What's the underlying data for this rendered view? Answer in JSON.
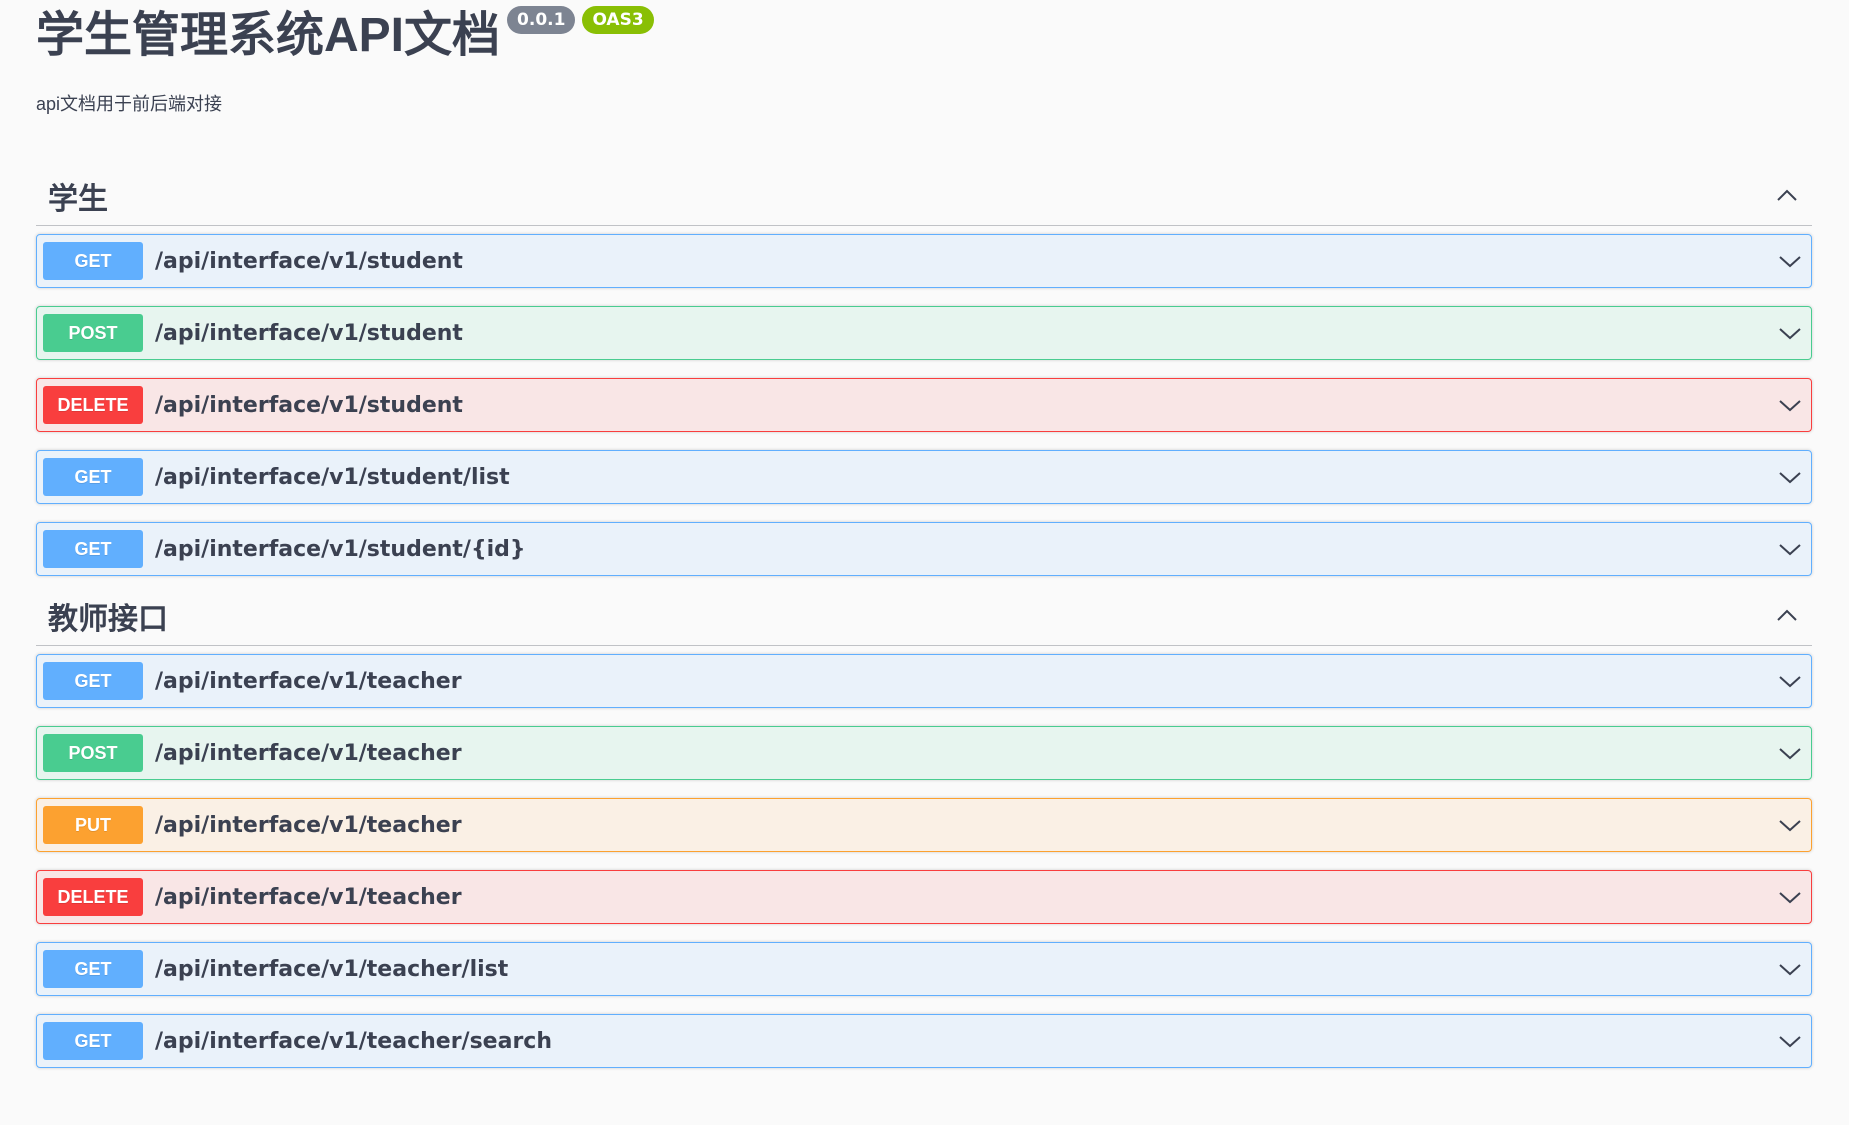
{
  "info": {
    "title": "学生管理系统API文档",
    "version": "0.0.1",
    "oas": "OAS3",
    "description": "api文档用于前后端对接"
  },
  "tags": [
    {
      "name": "学生",
      "operations": [
        {
          "method": "GET",
          "path": "/api/interface/v1/student"
        },
        {
          "method": "POST",
          "path": "/api/interface/v1/student"
        },
        {
          "method": "DELETE",
          "path": "/api/interface/v1/student"
        },
        {
          "method": "GET",
          "path": "/api/interface/v1/student/list"
        },
        {
          "method": "GET",
          "path": "/api/interface/v1/student/{id}"
        }
      ]
    },
    {
      "name": "教师接口",
      "operations": [
        {
          "method": "GET",
          "path": "/api/interface/v1/teacher"
        },
        {
          "method": "POST",
          "path": "/api/interface/v1/teacher"
        },
        {
          "method": "PUT",
          "path": "/api/interface/v1/teacher"
        },
        {
          "method": "DELETE",
          "path": "/api/interface/v1/teacher"
        },
        {
          "method": "GET",
          "path": "/api/interface/v1/teacher/list"
        },
        {
          "method": "GET",
          "path": "/api/interface/v1/teacher/search"
        }
      ]
    }
  ],
  "colors": {
    "get": "#61affe",
    "post": "#49cc90",
    "delete": "#f93e3e",
    "put": "#fca130",
    "text": "#3b4151"
  }
}
